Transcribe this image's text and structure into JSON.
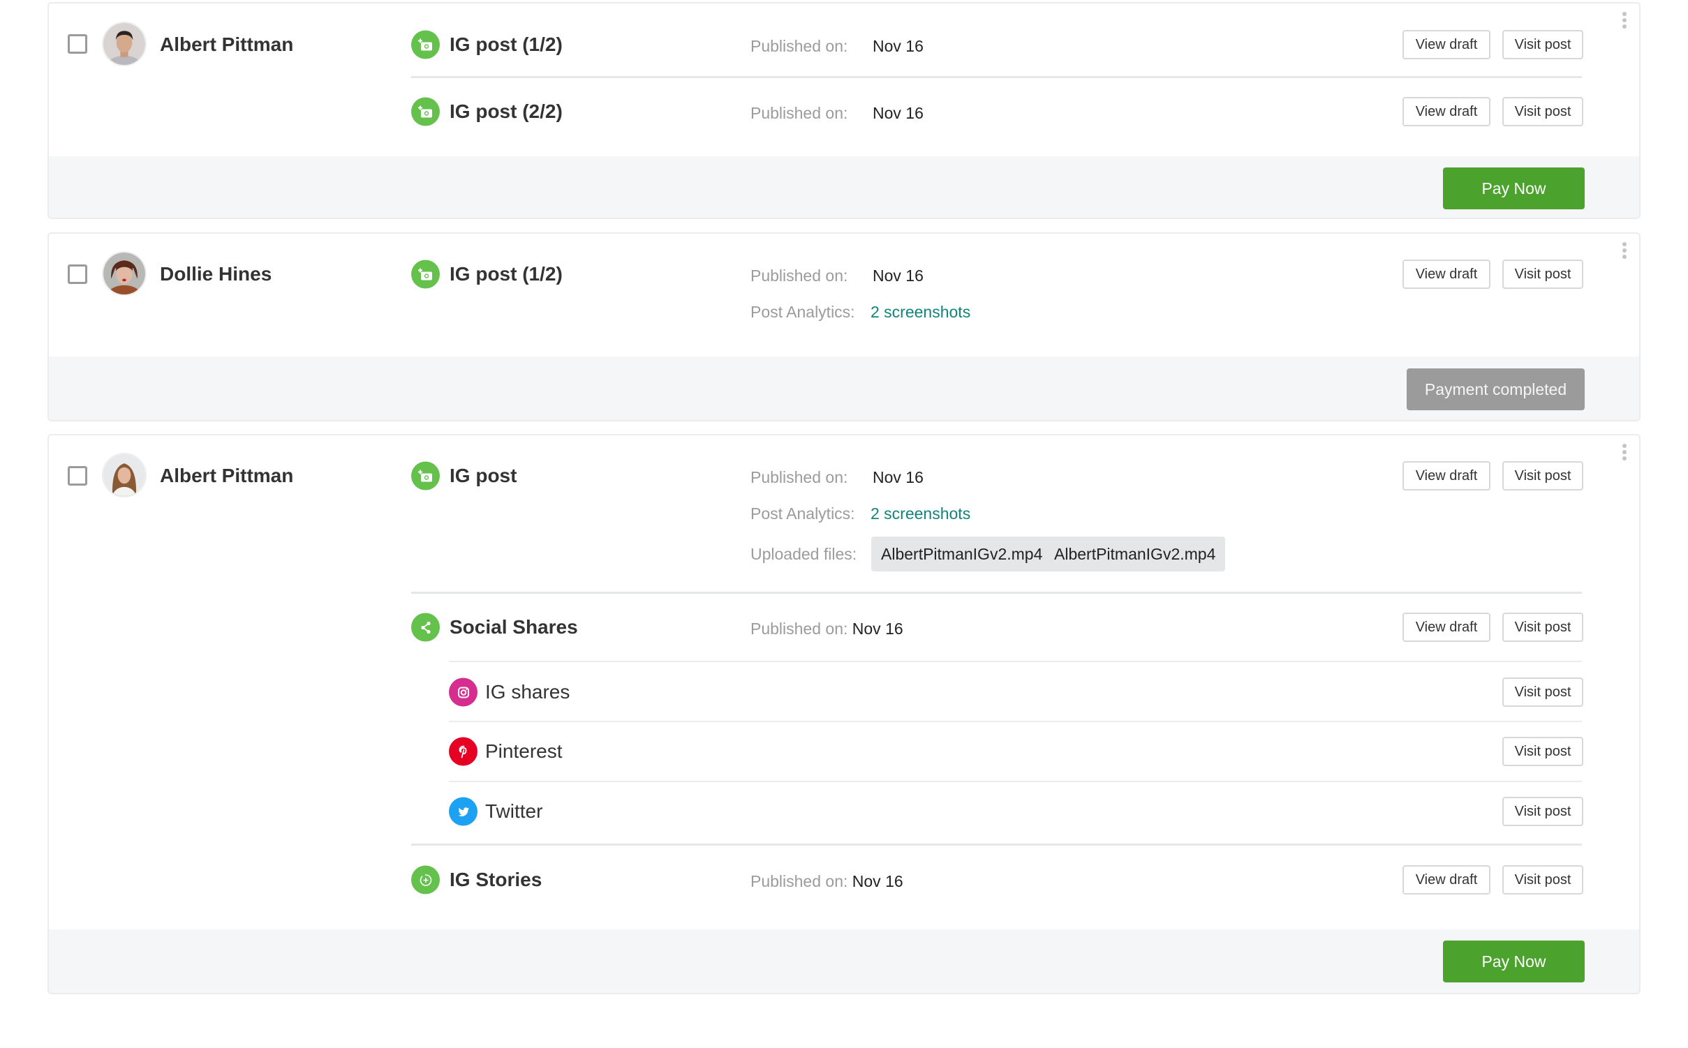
{
  "colors": {
    "accent_green": "#4ba22d",
    "icon_green": "#63c14c",
    "link_teal": "#11857a",
    "instagram": "#d62e8f",
    "pinterest": "#e60023",
    "twitter": "#1da1f2",
    "disabled_gray": "#9b9b9b"
  },
  "labels": {
    "published_on": "Published on:",
    "post_analytics": "Post Analytics:",
    "uploaded_files": "Uploaded files:",
    "view_draft": "View draft",
    "visit_post": "Visit post"
  },
  "cards": [
    {
      "creator": {
        "name": "Albert Pittman",
        "avatar": "avatar-man"
      },
      "items": [
        {
          "icon": "camera-plus-icon",
          "title": "IG post (1/2)",
          "published": "Nov 16"
        },
        {
          "icon": "camera-plus-icon",
          "title": "IG post (2/2)",
          "published": "Nov 16"
        }
      ],
      "footer": {
        "action": "Pay Now",
        "state": "pending"
      }
    },
    {
      "creator": {
        "name": "Dollie Hines",
        "avatar": "avatar-woman-bangs"
      },
      "items": [
        {
          "icon": "camera-plus-icon",
          "title": "IG post (1/2)",
          "published": "Nov 16",
          "analytics": "2 screenshots"
        }
      ],
      "footer": {
        "action": "Payment completed",
        "state": "completed"
      }
    },
    {
      "creator": {
        "name": "Albert Pittman",
        "avatar": "avatar-woman-long-hair"
      },
      "items": [
        {
          "icon": "camera-plus-icon",
          "title": "IG post",
          "published": "Nov 16",
          "analytics": "2 screenshots",
          "files": [
            "AlbertPitmanIGv2.mp4",
            "AlbertPitmanIGv2.mp4"
          ]
        },
        {
          "icon": "share-icon",
          "title": "Social Shares",
          "published": "Nov 16",
          "shares": [
            {
              "icon": "instagram-icon",
              "label": "IG shares"
            },
            {
              "icon": "pinterest-icon",
              "label": "Pinterest"
            },
            {
              "icon": "twitter-icon",
              "label": "Twitter"
            }
          ]
        },
        {
          "icon": "story-icon",
          "title": "IG Stories",
          "published": "Nov 16"
        }
      ],
      "footer": {
        "action": "Pay Now",
        "state": "pending"
      }
    }
  ]
}
